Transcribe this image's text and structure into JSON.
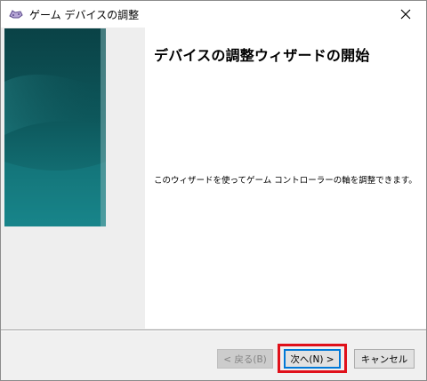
{
  "window": {
    "title": "ゲーム デバイスの調整",
    "close_symbol": "✕"
  },
  "wizard": {
    "heading": "デバイスの調整ウィザードの開始",
    "description": "このウィザードを使ってゲーム コントローラーの軸を調整できます。"
  },
  "buttons": {
    "back": "< 戻る(B)",
    "next": "次へ(N) >",
    "cancel": "キャンセル"
  },
  "colors": {
    "banner_dark": "#0b4e52",
    "banner_light": "#147a80",
    "highlight": "#e0101a",
    "focus": "#0078d7"
  },
  "icons": {
    "title": "game-controller-icon",
    "close": "close-icon"
  }
}
